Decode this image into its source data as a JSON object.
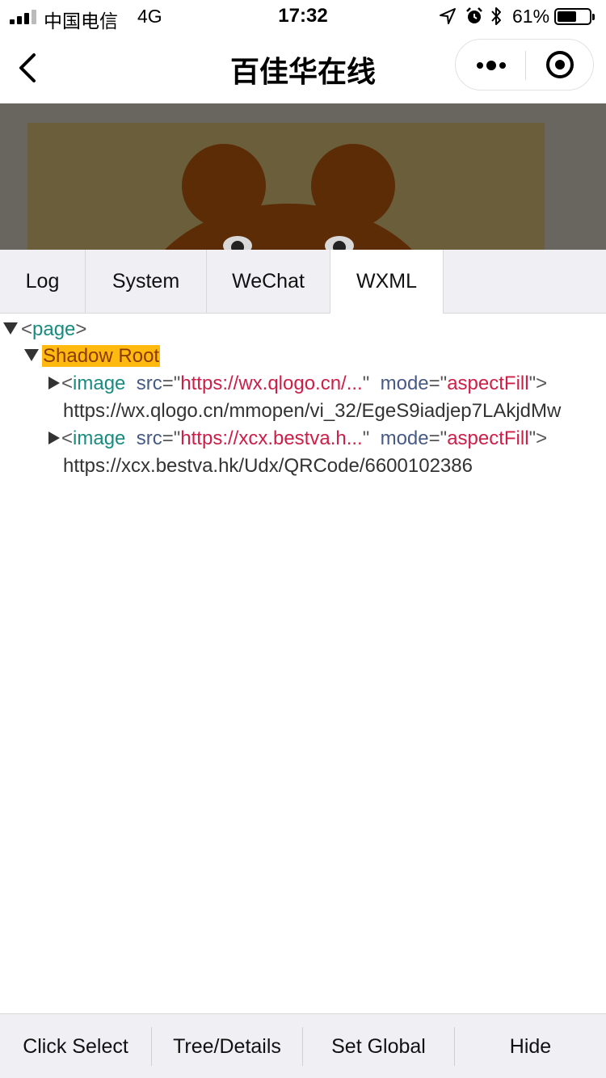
{
  "status_bar": {
    "carrier": "中国电信",
    "network": "4G",
    "time": "17:32",
    "battery_percent": "61%",
    "battery_level": 0.61
  },
  "nav_bar": {
    "title": "百佳华在线",
    "back_icon": "chevron-left-icon",
    "more_icon": "more-dots-icon",
    "target_icon": "target-icon"
  },
  "tabs": [
    {
      "label": "Log",
      "active": false
    },
    {
      "label": "System",
      "active": false
    },
    {
      "label": "WeChat",
      "active": false
    },
    {
      "label": "WXML",
      "active": true
    }
  ],
  "tree": {
    "page_tag": "page",
    "shadow_root": "Shadow Root",
    "nodes": [
      {
        "tag": "image",
        "src_attr": "src",
        "src": "https://wx.qlogo.cn/...",
        "mode_attr": "mode",
        "mode": "aspectFill",
        "content": "https://wx.qlogo.cn/mmopen/vi_32/EgeS9iadjep7LAkjdMw"
      },
      {
        "tag": "image",
        "src_attr": "src",
        "src": "https://xcx.bestva.h...",
        "mode_attr": "mode",
        "mode": "aspectFill",
        "content": "https://xcx.bestva.hk/Udx/QRCode/6600102386"
      }
    ]
  },
  "toolbar": {
    "click_select": "Click Select",
    "tree_details": "Tree/Details",
    "set_global": "Set Global",
    "hide": "Hide"
  },
  "colors": {
    "tag": "#1a8b7f",
    "attr": "#465a86",
    "value": "#cc1f48",
    "highlight": "#ffb90f",
    "panel_bg": "#efeff4"
  }
}
